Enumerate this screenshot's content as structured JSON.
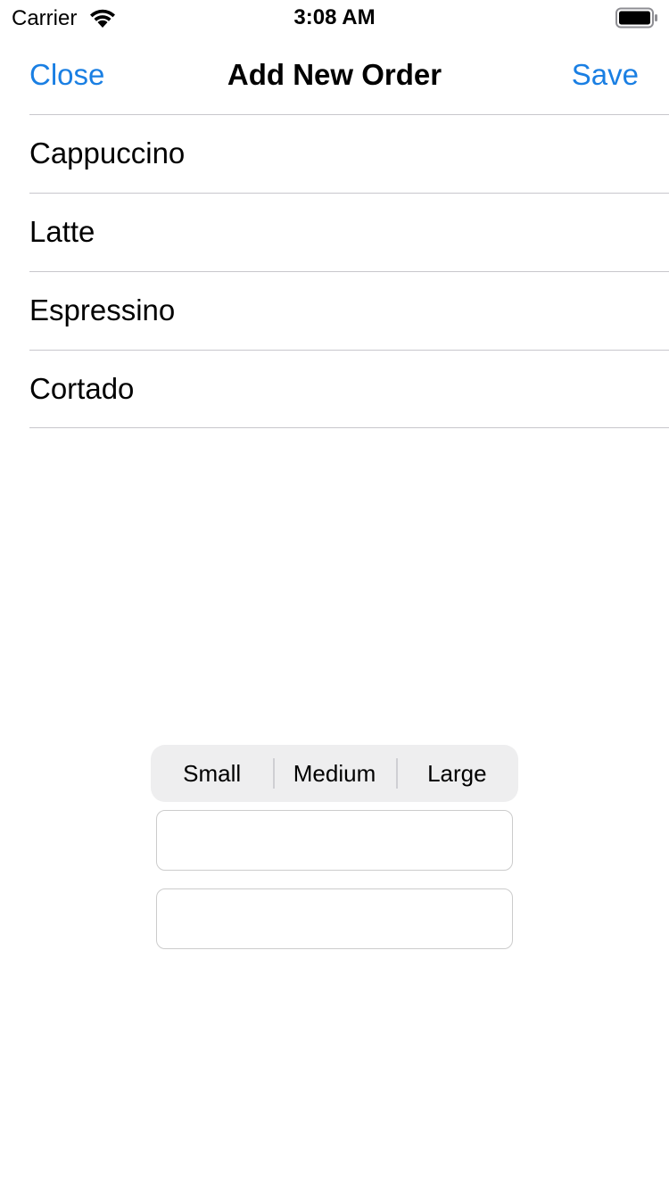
{
  "status_bar": {
    "carrier": "Carrier",
    "time": "3:08 AM",
    "wifi_icon": "wifi-icon",
    "battery_icon": "battery-full-icon"
  },
  "nav": {
    "close_label": "Close",
    "title": "Add New Order",
    "save_label": "Save"
  },
  "coffee_list": {
    "items": [
      {
        "label": "Cappuccino"
      },
      {
        "label": "Latte"
      },
      {
        "label": "Espressino"
      },
      {
        "label": "Cortado"
      }
    ]
  },
  "size_picker": {
    "segments": [
      {
        "label": "Small"
      },
      {
        "label": "Medium"
      },
      {
        "label": "Large"
      }
    ]
  },
  "fields": {
    "first": {
      "value": "",
      "placeholder": ""
    },
    "second": {
      "value": "",
      "placeholder": ""
    }
  },
  "colors": {
    "accent": "#1a7fe3",
    "separator": "#c8c7cc",
    "segmented_background": "#eeeeef"
  }
}
